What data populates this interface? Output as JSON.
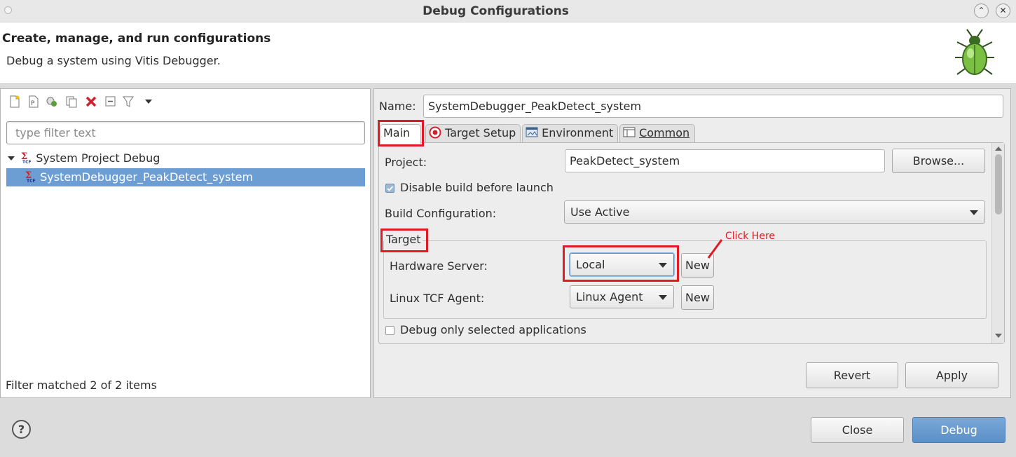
{
  "window": {
    "title": "Debug Configurations"
  },
  "header": {
    "title": "Create, manage, and run configurations",
    "description": "Debug a system using Vitis Debugger."
  },
  "left": {
    "filter_placeholder": "type filter text",
    "tree": [
      {
        "label": "System Project Debug",
        "expanded": true
      },
      {
        "label": "SystemDebugger_PeakDetect_system",
        "selected": true
      }
    ],
    "filter_status": "Filter matched 2 of 2 items"
  },
  "right": {
    "name_label": "Name:",
    "name_value": "SystemDebugger_PeakDetect_system",
    "tabs": [
      {
        "label": "Main",
        "active": true
      },
      {
        "label": "Target Setup"
      },
      {
        "label": "Environment"
      },
      {
        "label": "Common"
      }
    ],
    "main": {
      "project_label": "Project:",
      "project_value": "PeakDetect_system",
      "browse_label": "Browse...",
      "disable_build_label": "Disable build before launch",
      "disable_build_checked": true,
      "build_config_label": "Build Configuration:",
      "build_config_value": "Use Active",
      "target_group_label": "Target",
      "hw_server_label": "Hardware Server:",
      "hw_server_value": "Local",
      "hw_new_label": "New",
      "linux_agent_label": "Linux TCF Agent:",
      "linux_agent_value": "Linux Agent",
      "linux_new_label": "New",
      "debug_selected_label": "Debug only selected applications",
      "debug_selected_checked": false
    },
    "revert_label": "Revert",
    "apply_label": "Apply"
  },
  "annotation": {
    "text": "Click Here",
    "color": "#e01b24"
  },
  "footer": {
    "close_label": "Close",
    "debug_label": "Debug"
  },
  "colors": {
    "selection": "#6d9ed3",
    "highlight": "#e01b24",
    "primary_button": "#6a9ad0"
  }
}
